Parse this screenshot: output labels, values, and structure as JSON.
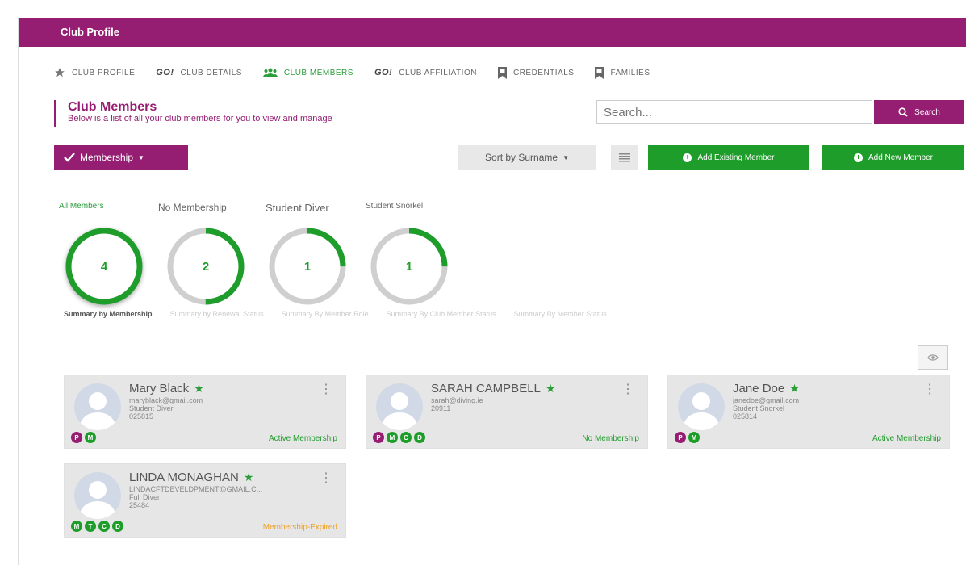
{
  "header": {
    "title": "Club Profile"
  },
  "tabs": [
    {
      "icon": "star-icon",
      "label": "CLUB PROFILE"
    },
    {
      "icon": "go-logo-icon",
      "prefix": "GO!",
      "label": "CLUB DETAILS"
    },
    {
      "icon": "users-icon",
      "label": "CLUB MEMBERS",
      "active": true
    },
    {
      "icon": "go-logo-icon",
      "prefix": "GO!",
      "label": "CLUB AFFILIATION"
    },
    {
      "icon": "bookmark-icon",
      "label": "CREDENTIALS"
    },
    {
      "icon": "bookmark-icon",
      "label": "FAMILIES"
    }
  ],
  "section": {
    "title": "Club Members",
    "subtitle": "Below is a list of all your club members for you to view and manage"
  },
  "search": {
    "placeholder": "Search...",
    "button_label": "Search"
  },
  "toolbar": {
    "membership_label": "Membership",
    "sort_label": "Sort by Surname",
    "add_existing_label": "Add Existing Member",
    "add_new_label": "Add New Member"
  },
  "filters": [
    {
      "label": "All Members",
      "count": "4",
      "fraction": 1.0,
      "active": true
    },
    {
      "label": "No Membership",
      "count": "2",
      "fraction": 0.5
    },
    {
      "label": "Student Diver",
      "count": "1",
      "fraction": 0.25
    },
    {
      "label": "Student Snorkel",
      "count": "1",
      "fraction": 0.25
    }
  ],
  "summary_tabs": [
    {
      "label": "Summary by Membership",
      "active": true
    },
    {
      "label": "Summary by Renewal Status"
    },
    {
      "label": "Summary By Member Role"
    },
    {
      "label": "Summary By Club Member Status"
    },
    {
      "label": "Summary By Member Status"
    }
  ],
  "members": [
    {
      "name": "Mary Black",
      "email": "maryblack@gmail.com",
      "type": "Student Diver",
      "id": "025815",
      "badges": [
        "P",
        "M"
      ],
      "status": "Active Membership",
      "status_color": "#1f9d2a"
    },
    {
      "name": "SARAH CAMPBELL",
      "email": "sarah@diving.ie",
      "type": "",
      "id": "20911",
      "badges": [
        "P",
        "M",
        "C",
        "D"
      ],
      "status": "No Membership",
      "status_color": "#1f9d2a"
    },
    {
      "name": "Jane Doe",
      "email": "janedoe@gmail.com",
      "type": "Student Snorkel",
      "id": "025814",
      "badges": [
        "P",
        "M"
      ],
      "status": "Active Membership",
      "status_color": "#1f9d2a"
    },
    {
      "name": "LINDA MONAGHAN",
      "email": "LINDACFTDEVELDPMENT@GMAIL.C...",
      "type": "Full Diver",
      "id": "25484",
      "badges": [
        "M",
        "T",
        "C",
        "D"
      ],
      "status": "Membership-Expired",
      "status_color": "#f0a020"
    }
  ],
  "colors": {
    "brand": "#951d72",
    "accent": "#1f9d2a",
    "badge_purple": "#951d72",
    "badge_green": "#1f9d2a"
  }
}
